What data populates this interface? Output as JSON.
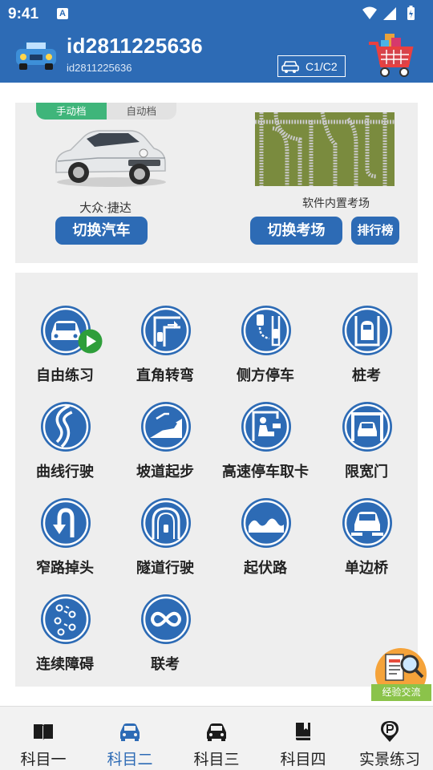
{
  "status_bar": {
    "time": "9:41",
    "notification_badge": "A"
  },
  "header": {
    "user_name": "id2811225636",
    "user_sub": "id2811225636",
    "license_label": "C1/C2",
    "bg_color": "#2d6bb5"
  },
  "mode_card": {
    "gear_options": [
      "手动档",
      "自动档"
    ],
    "active_gear": "手动档",
    "car_name": "大众·捷达",
    "switch_car_label": "切换汽车",
    "track_name": "软件内置考场",
    "switch_track_label": "切换考场",
    "ranking_label": "排行榜"
  },
  "practice_items": [
    {
      "label": "自由练习",
      "icon": "car-front-icon"
    },
    {
      "label": "直角转弯",
      "icon": "right-angle-turn-icon"
    },
    {
      "label": "侧方停车",
      "icon": "side-parking-icon"
    },
    {
      "label": "桩考",
      "icon": "pile-test-icon"
    },
    {
      "label": "曲线行驶",
      "icon": "curve-driving-icon"
    },
    {
      "label": "坡道起步",
      "icon": "slope-start-icon"
    },
    {
      "label": "高速停车取卡",
      "icon": "toll-card-icon"
    },
    {
      "label": "限宽门",
      "icon": "width-gate-icon"
    },
    {
      "label": "窄路掉头",
      "icon": "u-turn-icon"
    },
    {
      "label": "隧道行驶",
      "icon": "tunnel-icon"
    },
    {
      "label": "起伏路",
      "icon": "bumpy-road-icon"
    },
    {
      "label": "单边桥",
      "icon": "single-bridge-icon"
    },
    {
      "label": "连续障碍",
      "icon": "obstacles-icon"
    },
    {
      "label": "联考",
      "icon": "combined-exam-icon"
    }
  ],
  "exchange_label": "经验交流",
  "bottom_nav": [
    {
      "label": "科目一",
      "icon": "book-icon"
    },
    {
      "label": "科目二",
      "icon": "car-icon"
    },
    {
      "label": "科目三",
      "icon": "car-road-icon"
    },
    {
      "label": "科目四",
      "icon": "book-bookmark-icon"
    },
    {
      "label": "实景练习",
      "icon": "parking-pin-icon"
    }
  ],
  "active_nav": "科目二",
  "colors": {
    "accent": "#2d6bb5",
    "green": "#3fb57a",
    "active_nav": "#2d6bb5"
  }
}
